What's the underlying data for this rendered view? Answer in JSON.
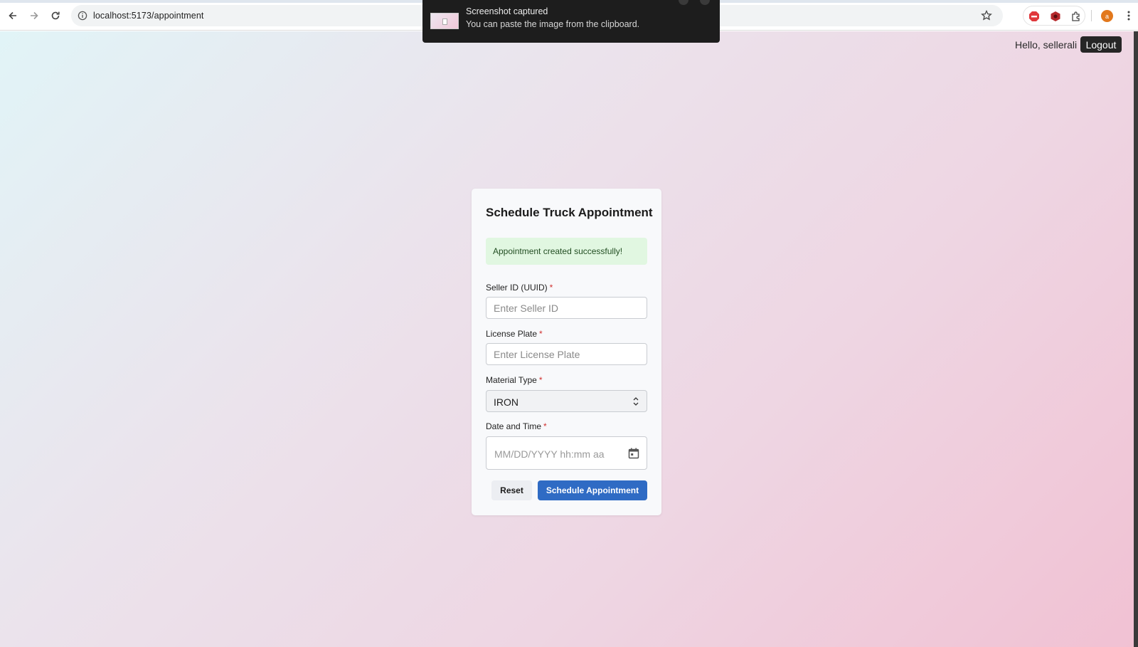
{
  "browser": {
    "url": "localhost:5173/appointment",
    "profile_initial": "a",
    "extensions": [
      "adblock-icon",
      "shield-extension-icon",
      "puzzle-icon"
    ]
  },
  "toast": {
    "title": "Screenshot captured",
    "message": "You can paste the image from the clipboard."
  },
  "header": {
    "greeting": "Hello, sellerali",
    "logout_label": "Logout"
  },
  "form": {
    "title": "Schedule Truck Appointment",
    "success_message": "Appointment created successfully!",
    "required_marker": "*",
    "fields": {
      "seller_id": {
        "label": "Seller ID (UUID)",
        "placeholder": "Enter Seller ID",
        "value": ""
      },
      "license_plate": {
        "label": "License Plate",
        "placeholder": "Enter License Plate",
        "value": ""
      },
      "material_type": {
        "label": "Material Type",
        "value": "IRON"
      },
      "date_time": {
        "label": "Date and Time",
        "placeholder": "MM/DD/YYYY hh:mm aa"
      }
    },
    "buttons": {
      "reset": "Reset",
      "submit": "Schedule Appointment"
    }
  },
  "colors": {
    "primary": "#2f6bc4",
    "success_bg": "#e1f7e1",
    "required": "#d0302e",
    "logout_bg": "#262626"
  }
}
